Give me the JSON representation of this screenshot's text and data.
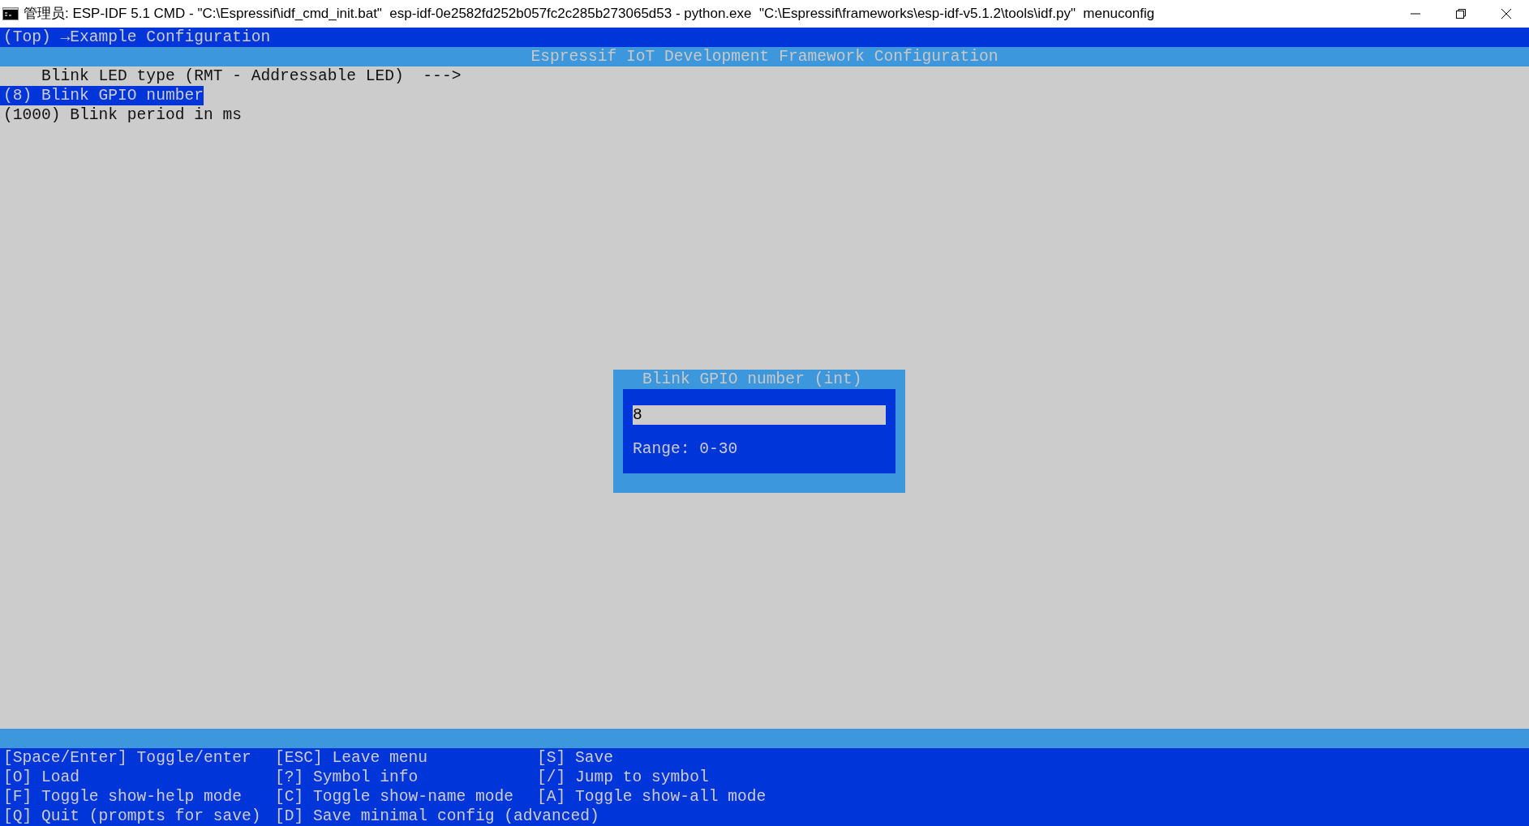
{
  "window": {
    "title": "管理员: ESP-IDF 5.1 CMD - \"C:\\Espressif\\idf_cmd_init.bat\"  esp-idf-0e2582fd252b057fc2c285b273065d53 - python.exe  \"C:\\Espressif\\frameworks\\esp-idf-v5.1.2\\tools\\idf.py\"  menuconfig"
  },
  "breadcrumb": "(Top) →Example Configuration",
  "header": "Espressif IoT Development Framework Configuration",
  "menu_items": [
    {
      "text": "    Blink LED type (RMT - Addressable LED)  --->",
      "selected": false
    },
    {
      "text": "(8) Blink GPIO number",
      "selected": true
    },
    {
      "text": "(1000) Blink period in ms",
      "selected": false
    }
  ],
  "dialog": {
    "title": "Blink GPIO number (int)",
    "value": "8",
    "range": "Range: 0-30"
  },
  "footer_rows": [
    [
      "[Space/Enter] Toggle/enter",
      "[ESC] Leave menu",
      "[S] Save"
    ],
    [
      "[O] Load",
      "[?] Symbol info",
      "[/] Jump to symbol"
    ],
    [
      "[F] Toggle show-help mode",
      "[C] Toggle show-name mode",
      "[A] Toggle show-all mode"
    ],
    [
      "[Q] Quit (prompts for save)",
      "[D] Save minimal config (advanced)"
    ]
  ]
}
